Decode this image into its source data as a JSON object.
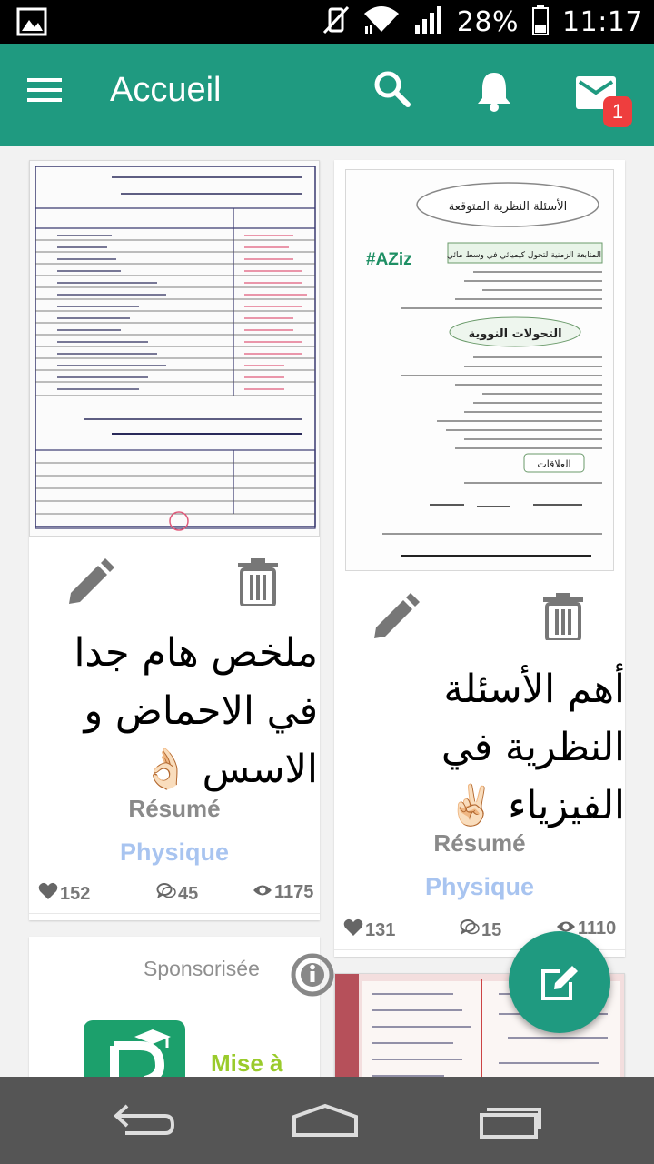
{
  "status_bar": {
    "battery": "28%",
    "time": "11:17"
  },
  "app_bar": {
    "title": "Accueil",
    "mail_badge": "1"
  },
  "colors": {
    "primary": "#1f9a80",
    "badge": "#ee3e3e",
    "subject": "#a8c4f0",
    "ad_cta": "#9acb2c"
  },
  "posts": [
    {
      "title": "ملخص هام جدا في الاحماض و الاسس 👌🏻",
      "type": "Résumé",
      "subject": "Physique",
      "likes": "152",
      "comments": "45",
      "views": "1175"
    },
    {
      "title": "أهم الأسئلة النظرية في الفيزياء ✌🏻",
      "type": "Résumé",
      "subject": "Physique",
      "likes": "131",
      "comments": "15",
      "views": "1110",
      "thumb_heading": "الأسئلة النظرية المتوقعة",
      "thumb_tag": "#AZiz",
      "thumb_section_1": "المتابعة الزمنية لتحول كيميائي في وسط مائي",
      "thumb_section_2": "التحولات النووية",
      "thumb_section_3": "العلاقات"
    }
  ],
  "ad": {
    "label": "Sponsorisée",
    "cta": "Mise à jour"
  },
  "icons": [
    "menu-icon",
    "search-icon",
    "bell-icon",
    "mail-icon",
    "pencil-icon",
    "trash-icon",
    "heart-icon",
    "comment-icon",
    "eye-icon",
    "info-icon",
    "compose-icon",
    "back-icon",
    "home-icon",
    "recents-icon"
  ]
}
